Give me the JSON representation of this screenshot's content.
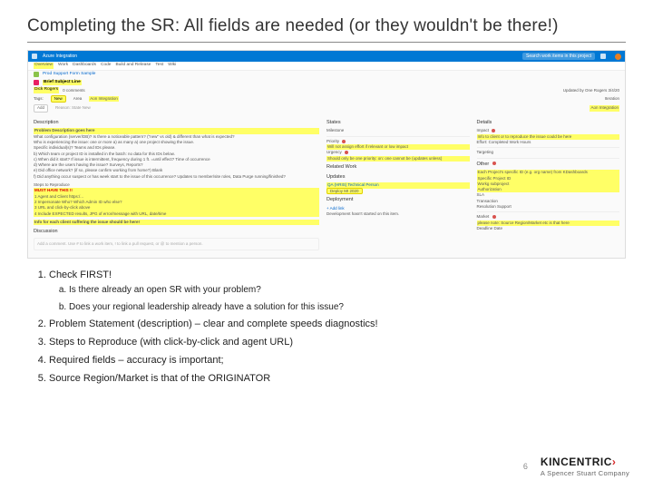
{
  "title": "Completing the SR: All fields are needed (or they wouldn't be there!)",
  "screenshot": {
    "topbar": {
      "app": "Azure Integration",
      "search": "Search work items in this project"
    },
    "menu": {
      "overview": "Overview",
      "work": "Work",
      "dashboards": "Dashboards",
      "code": "Code",
      "build": "Build and Release",
      "test": "Test",
      "wiki": "Wiki"
    },
    "breadcrumb": "Prod Support Form Sample",
    "ticket": {
      "title": "Brief Subject Line",
      "owner": "Dick Rogers",
      "comments": "0 comments",
      "tags_label": "Tags:",
      "tag_add": "Add",
      "area_label": "Area",
      "area_value": "Aon Integration",
      "iteration_label": "Iteration",
      "iteration_value": "Aon Integration"
    },
    "description": {
      "heading": "Description",
      "problem_heading": "Problem Description goes here",
      "lines": [
        "What configuration (server/DB)? Is there a noticeable pattern? (\"new\" vs old) & different than what is expected?",
        "Who is experiencing the issue: one or more a) as many a) one project showing the issue.",
        "Specific individual(s)? Teams and IDs please.",
        "b) Which team or project ID is installed in the batch: no data for this IDs below.",
        "c) When did it start? If issue is intermittent, frequency during 1 ft. =until effect? Time of occurrence",
        "d) Where are the users having the issue? Surveys, Reports?",
        "e) Did office network? (if so, please confirm working from home?) Blank",
        "f) Did anything occur suspect or has week start to the issue of this occurrence? Updates to member/site roles, Data Purge running/finished?"
      ],
      "steps_heading": "Steps to Reproduce",
      "must": "MUST HAVE THIS !!",
      "steps": [
        "Agent and Client https:/...",
        "Impersonate Who? Which Admin ID who else?",
        "URL and click-by-click above",
        "Include EXPECTED results, JPG of error/message with URL, date/time"
      ],
      "footer": "Info for each client suffering the issue should be here!"
    },
    "states": {
      "heading": "States",
      "milestone": "Milestone",
      "priority": "Priority",
      "pnote": "Will not assign effort if relevant or low impact",
      "urgency": "Urgency",
      "unote": "Should only be one priority: on: one cannot be (updates unless)",
      "related": "Related Work",
      "updates": "Updates",
      "upd1": "QA (HRIS) Technical Person",
      "upd_badge": "Deploy MI 2020",
      "deploy": "Deployment",
      "deploy_btn": "+ Add link",
      "deploy_note": "Development hasn't started on this item."
    },
    "details": {
      "heading": "Details",
      "impact": "Impact",
      "impact_note": "Info to client or to reproduce the issue could be here",
      "effort": "Effort: Completed Work Hours",
      "targeting": "Targeting",
      "other": "Other",
      "other_note": "Each Project's specific ID (e.g. org name) from KDashboards",
      "hl1": "Specific Project ID",
      "hl2": "Workg subproject",
      "hl3": "Authorization",
      "sla": "SLA",
      "tr": "Transaction",
      "res": "Resolution Support",
      "mkt": "Market",
      "mkt_note": "please note: Source Region/Market etc is that here",
      "line": "Deadline Date",
      "upd": "Updated by One Rogers 3/4/20"
    },
    "discussion": {
      "heading": "Discussion",
      "ph": "Add a comment. Use # to link a work item, ! to link a pull request, or @ to mention a person."
    },
    "status": {
      "new": "New",
      "state": "Reason: State New"
    }
  },
  "notes": {
    "n1": "Check FIRST!",
    "n1a": "Is there already an open SR with your problem?",
    "n1b": "Does your regional leadership already have a solution for this issue?",
    "n2": "Problem Statement (description) – clear and complete speeds diagnostics!",
    "n3": "Steps to Reproduce (with click-by-click and agent URL)",
    "n4": "Required fields – accuracy is important;",
    "n5": "Source Region/Market is that of the ORIGINATOR"
  },
  "footer": {
    "page": "6",
    "brand": "KINCENTRIC",
    "sub": "A Spencer Stuart Company"
  }
}
